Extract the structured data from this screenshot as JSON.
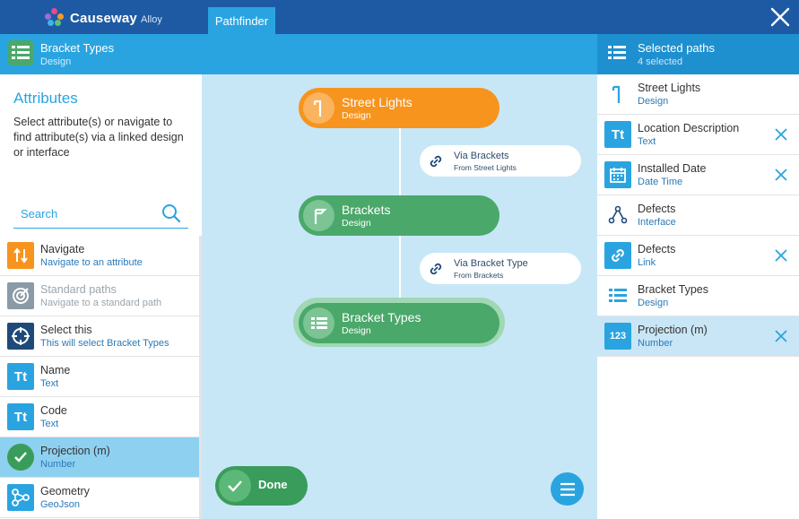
{
  "app": {
    "brand": "Causeway",
    "brand_sub": "Alloy",
    "active_tab": "Pathfinder"
  },
  "header": {
    "title": "Bracket Types",
    "subtitle": "Design"
  },
  "selected_header": {
    "title": "Selected paths",
    "subtitle": "4 selected"
  },
  "left": {
    "title": "Attributes",
    "description": "Select attribute(s) or navigate to find attribute(s) via a linked design or interface",
    "search_placeholder": "Search",
    "items": [
      {
        "label": "Navigate",
        "sub": "Navigate to an attribute",
        "icon": "navigate-icon"
      },
      {
        "label": "Standard paths",
        "sub": "Navigate to a standard path",
        "icon": "target-icon"
      },
      {
        "label": "Select this",
        "sub": "This will select Bracket Types",
        "icon": "crosshair-icon"
      },
      {
        "label": "Name",
        "sub": "Text",
        "icon": "text-icon",
        "icon_text": "Tt"
      },
      {
        "label": "Code",
        "sub": "Text",
        "icon": "text-icon",
        "icon_text": "Tt"
      },
      {
        "label": "Projection (m)",
        "sub": "Number",
        "icon": "check-icon"
      },
      {
        "label": "Geometry",
        "sub": "GeoJson",
        "icon": "geometry-icon"
      }
    ]
  },
  "canvas": {
    "nodes": [
      {
        "title": "Street Lights",
        "sub": "Design"
      },
      {
        "title": "Brackets",
        "sub": "Design"
      },
      {
        "title": "Bracket Types",
        "sub": "Design"
      }
    ],
    "links": [
      {
        "title": "Via Brackets",
        "sub": "From Street Lights"
      },
      {
        "title": "Via Bracket Type",
        "sub": "From Brackets"
      }
    ],
    "done_label": "Done"
  },
  "right": {
    "items": [
      {
        "label": "Street Lights",
        "sub": "Design",
        "icon": "street-light-icon"
      },
      {
        "label": "Location Description",
        "sub": "Text",
        "icon": "text-icon",
        "icon_text": "Tt"
      },
      {
        "label": "Installed Date",
        "sub": "Date Time",
        "icon": "calendar-icon"
      },
      {
        "label": "Defects",
        "sub": "Interface",
        "icon": "interface-icon"
      },
      {
        "label": "Defects",
        "sub": "Link",
        "icon": "link-icon"
      },
      {
        "label": "Bracket Types",
        "sub": "Design",
        "icon": "list-icon"
      },
      {
        "label": "Projection (m)",
        "sub": "Number",
        "icon": "number-icon",
        "icon_text": "123"
      }
    ]
  },
  "colors": {
    "topbar": "#1e5aa4",
    "accent": "#2aa4e0",
    "orange": "#f7941e",
    "green": "#4aa86a",
    "canvas": "#c7e7f7"
  }
}
